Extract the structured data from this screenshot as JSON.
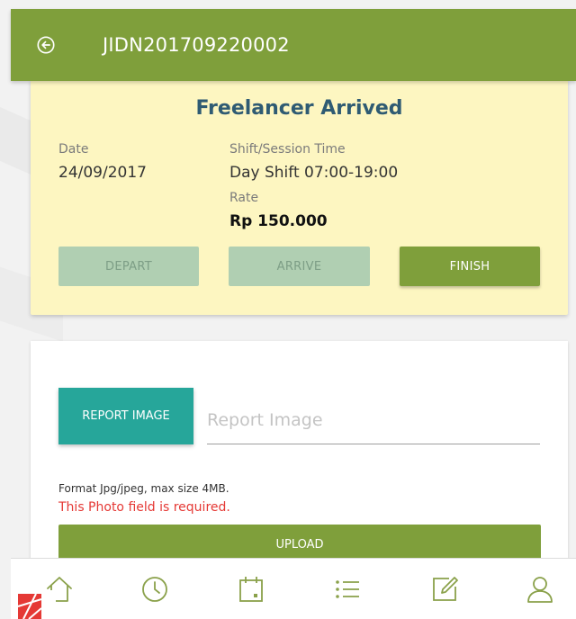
{
  "header": {
    "title": "JIDN201709220002",
    "back_icon": "arrow-left-circle-icon",
    "background": "#7f9f3b"
  },
  "status_card": {
    "title": "Freelancer Arrived",
    "date_label": "Date",
    "date_value": "24/09/2017",
    "shift_label": "Shift/Session Time",
    "shift_value": "Day Shift 07:00-19:00",
    "rate_label": "Rate",
    "rate_value": "Rp 150.000",
    "buttons": {
      "depart": "DEPART",
      "arrive": "ARRIVE",
      "finish": "FINISH"
    },
    "background": "#fdf6c1"
  },
  "report_card": {
    "report_button": "REPORT IMAGE",
    "input_placeholder": "Report Image",
    "format_hint": "Format Jpg/jpeg, max size 4MB.",
    "error": "This Photo field is required.",
    "upload_button": "UPLOAD",
    "accent": "#26a69a"
  },
  "bottom_nav": {
    "items": [
      {
        "icon": "home-icon"
      },
      {
        "icon": "clock-icon"
      },
      {
        "icon": "calendar-icon"
      },
      {
        "icon": "list-icon"
      },
      {
        "icon": "edit-icon"
      },
      {
        "icon": "user-icon"
      }
    ],
    "icon_color": "#8aa14a"
  }
}
